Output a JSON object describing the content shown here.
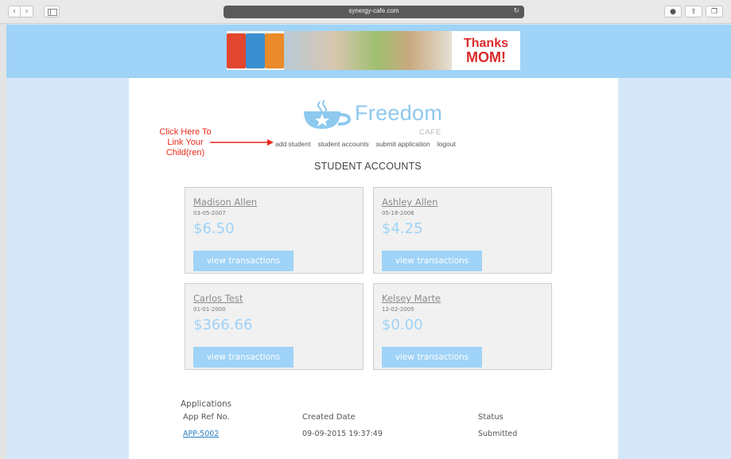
{
  "browser": {
    "url": "synergy-cafe.com",
    "reload_icon": "reload-icon",
    "back_glyph": "‹",
    "forward_glyph": "›"
  },
  "banner": {
    "thanks_line1": "Thanks",
    "thanks_line2": "MOM!"
  },
  "logo": {
    "name": "Freedom",
    "sub": "CAFE",
    "color": "#8ec9ee"
  },
  "annotation": {
    "text": "Click Here To Link Your Child(ren)",
    "color": "#e8291b"
  },
  "nav": {
    "items": [
      "add student",
      "student accounts",
      "submit application",
      "logout"
    ]
  },
  "page": {
    "heading": "STUDENT ACCOUNTS"
  },
  "students": [
    {
      "name": "Madison Allen",
      "dob": "03-05-2007",
      "balance": "$6.50",
      "button": "view transactions"
    },
    {
      "name": "Ashley Allen",
      "dob": "05-18-2006",
      "balance": "$4.25",
      "button": "view transactions"
    },
    {
      "name": "Carlos Test",
      "dob": "01-01-2000",
      "balance": "$366.66",
      "button": "view transactions"
    },
    {
      "name": "Kelsey Marte",
      "dob": "12-02-2005",
      "balance": "$0.00",
      "button": "view transactions"
    }
  ],
  "applications": {
    "title": "Applications",
    "columns": [
      "App Ref No.",
      "Created Date",
      "Status"
    ],
    "rows": [
      {
        "ref": "APP-5002",
        "created": "09-09-2015 19:37:49",
        "status": "Submitted"
      }
    ]
  },
  "colors": {
    "accent": "#9fd3f7",
    "band": "#9fd3f7",
    "background": "#d6e8f7"
  }
}
